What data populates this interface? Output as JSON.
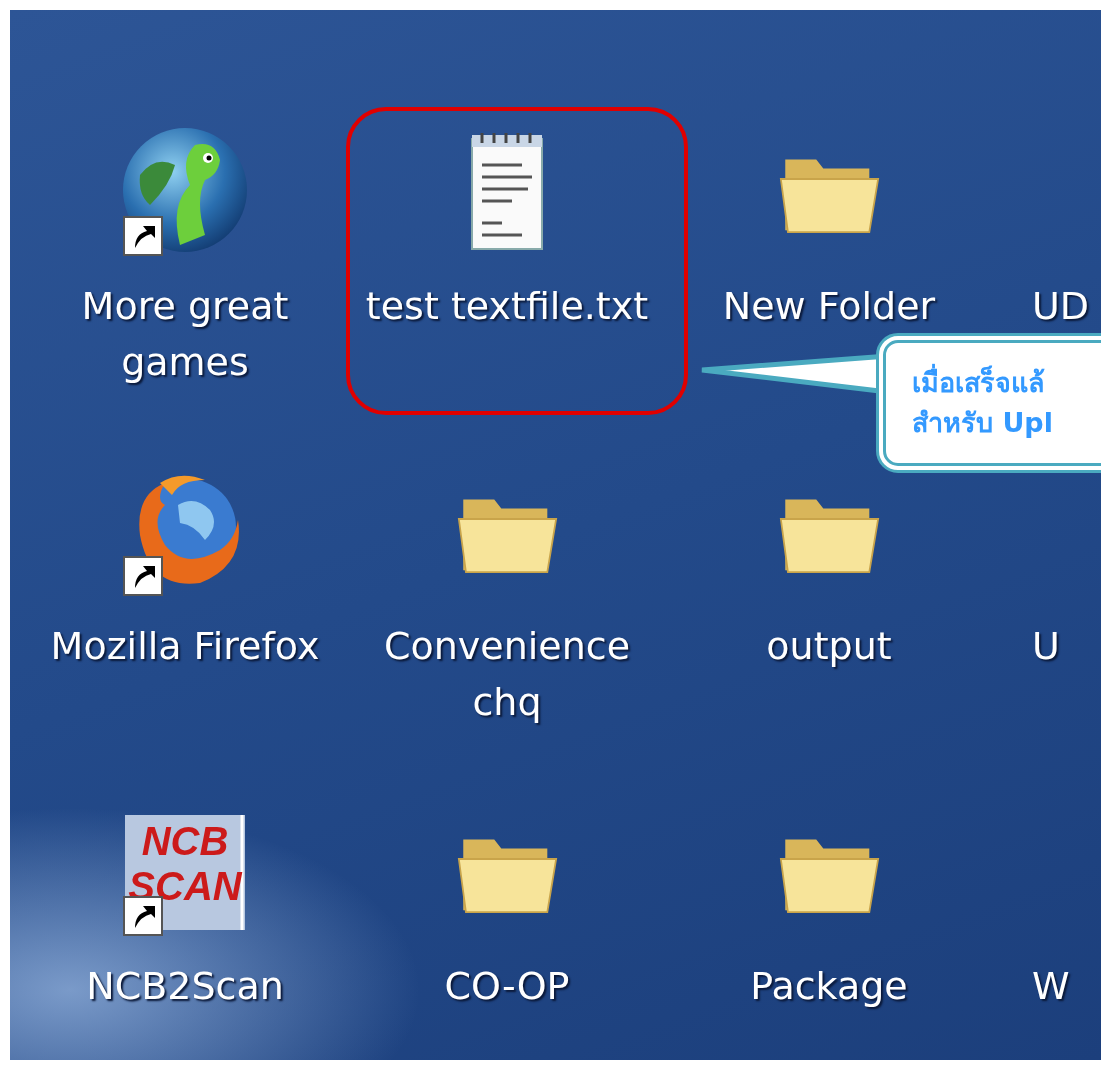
{
  "desktop": {
    "icons": [
      {
        "label": "More great games",
        "kind": "globe",
        "shortcut": true,
        "highlighted": false
      },
      {
        "label": "test textfile.txt",
        "kind": "notepad",
        "shortcut": false,
        "highlighted": true
      },
      {
        "label": "New Folder",
        "kind": "folder",
        "shortcut": false,
        "highlighted": false
      },
      {
        "label": "UD",
        "kind": "hidden",
        "shortcut": false,
        "highlighted": false
      },
      {
        "label": "Mozilla Firefox",
        "kind": "firefox",
        "shortcut": true,
        "highlighted": false
      },
      {
        "label": "Convenience chq",
        "kind": "folder",
        "shortcut": false,
        "highlighted": false
      },
      {
        "label": "output",
        "kind": "folder",
        "shortcut": false,
        "highlighted": false
      },
      {
        "label": "U",
        "kind": "hidden",
        "shortcut": false,
        "highlighted": false
      },
      {
        "label": "NCB2Scan",
        "kind": "logo",
        "logo_lines": [
          "NCB",
          "SCAN"
        ],
        "shortcut": true,
        "highlighted": false
      },
      {
        "label": "CO-OP",
        "kind": "folder",
        "shortcut": false,
        "highlighted": false
      },
      {
        "label": "Package",
        "kind": "folder",
        "shortcut": false,
        "highlighted": false
      },
      {
        "label": "W",
        "kind": "hidden",
        "shortcut": false,
        "highlighted": false
      }
    ]
  },
  "callout": {
    "lines": [
      "เมื่อเสร็จแล้",
      "สำหรับ Upl"
    ]
  }
}
